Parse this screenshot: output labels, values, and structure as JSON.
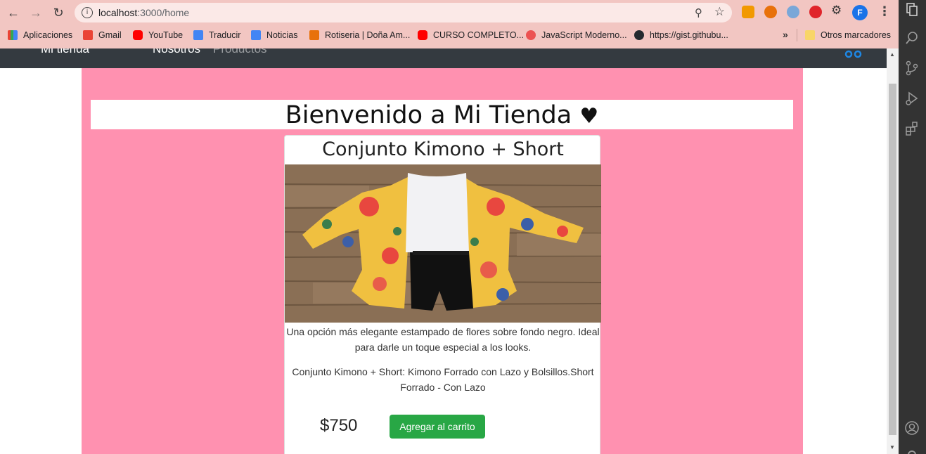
{
  "browser": {
    "url_host": "localhost",
    "url_path": ":3000/home",
    "profile_initial": "F",
    "bookmarks": [
      {
        "label": "Aplicaciones",
        "icon": "apps-grid-icon"
      },
      {
        "label": "Gmail",
        "icon": "gmail-icon"
      },
      {
        "label": "YouTube",
        "icon": "youtube-icon"
      },
      {
        "label": "Traducir",
        "icon": "translate-icon"
      },
      {
        "label": "Noticias",
        "icon": "news-icon"
      },
      {
        "label": "Rotiseria | Doña Am...",
        "icon": "rotiseria-icon"
      },
      {
        "label": "CURSO COMPLETO...",
        "icon": "youtube-icon"
      },
      {
        "label": "JavaScript Moderno...",
        "icon": "udemy-icon"
      },
      {
        "label": "https://gist.githubu...",
        "icon": "github-icon"
      }
    ],
    "bookmarks_more": "»",
    "other_bookmarks": "Otros marcadores"
  },
  "site": {
    "brand": "Mi tienda",
    "nav_links": [
      "Nosotros",
      "Productos"
    ],
    "welcome": "Bienvenido a Mi Tienda",
    "welcome_heart": "♥"
  },
  "product": {
    "title": "Conjunto Kimono + Short",
    "description": "Una opción más elegante estampado de flores sobre fondo negro. Ideal para darle un toque especial a los looks.",
    "details": "Conjunto Kimono + Short: Kimono Forrado con Lazo y Bolsillos.Short Forrado - Con Lazo",
    "price": "$750",
    "add_button": "Agregar al carrito"
  },
  "colors": {
    "page_bg": "#ff91b0",
    "navbar": "#343a40",
    "button": "#28a745",
    "chrome": "#f2c6c2"
  }
}
